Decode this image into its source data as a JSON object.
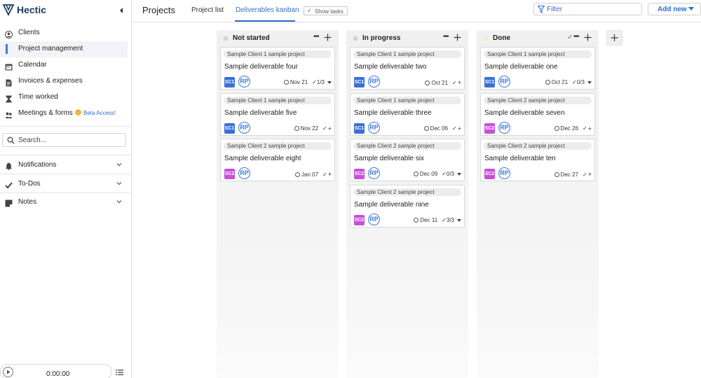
{
  "app": {
    "name": "Hectic"
  },
  "nav": {
    "items": [
      {
        "label": "Clients",
        "icon": "person-circle-icon"
      },
      {
        "label": "Project management",
        "icon": "kanban-icon",
        "active": true
      },
      {
        "label": "Calendar",
        "icon": "calendar-icon"
      },
      {
        "label": "Invoices & expenses",
        "icon": "document-icon"
      },
      {
        "label": "Time worked",
        "icon": "hourglass-icon"
      },
      {
        "label": "Meetings & forms",
        "icon": "people-icon"
      }
    ],
    "beta_label": "Beta Access!"
  },
  "search": {
    "placeholder": "Search..."
  },
  "sections": [
    {
      "label": "Notifications",
      "icon": "bell-icon"
    },
    {
      "label": "To-Dos",
      "icon": "check-icon"
    },
    {
      "label": "Notes",
      "icon": "notes-icon"
    }
  ],
  "timer": {
    "value": "0:00:00"
  },
  "header": {
    "title": "Projects",
    "tabs": [
      "Project list",
      "Deliverables kanban"
    ],
    "active_tab": 1,
    "show_tasks": "Show tasks",
    "filter_placeholder": "Filter",
    "add_new": "Add new"
  },
  "colors": {
    "accent": "#2f6ec9",
    "badge_sc1": "#3b6fd8",
    "badge_sc2": "#c94fd8",
    "status_not_started": "#cfd6de",
    "status_in_progress": "#b9d8f2",
    "status_done": "#f1ecc4"
  },
  "columns": [
    {
      "title": "Not started",
      "dot_color": "#cfd6de",
      "show_check": false,
      "cards": [
        {
          "project": "Sample Client 1 sample project",
          "title": "Sample deliverable four",
          "client": "SC1",
          "avatar": "RP",
          "date": "Nov 21",
          "tasks": "1/3",
          "tasks_mode": "caret"
        },
        {
          "project": "Sample Client 1 sample project",
          "title": "Sample deliverable five",
          "client": "SC1",
          "avatar": "RP",
          "date": "Nov 22",
          "tasks": "",
          "tasks_mode": "plus"
        },
        {
          "project": "Sample Client 2 sample project",
          "title": "Sample deliverable eight",
          "client": "SC2",
          "avatar": "RP",
          "date": "Jan 07",
          "tasks": "",
          "tasks_mode": "plus"
        }
      ]
    },
    {
      "title": "In progress",
      "dot_color": "#b9d8f2",
      "show_check": false,
      "cards": [
        {
          "project": "Sample Client 1 sample project",
          "title": "Sample deliverable two",
          "client": "SC1",
          "avatar": "RP",
          "date": "Oct 21",
          "tasks": "",
          "tasks_mode": "plus"
        },
        {
          "project": "Sample Client 1 sample project",
          "title": "Sample deliverable three",
          "client": "SC1",
          "avatar": "RP",
          "date": "Dec 06",
          "tasks": "",
          "tasks_mode": "plus"
        },
        {
          "project": "Sample Client 2 sample project",
          "title": "Sample deliverable six",
          "client": "SC2",
          "avatar": "RP",
          "date": "Dec 09",
          "tasks": "0/3",
          "tasks_mode": "caret"
        },
        {
          "project": "Sample Client 2 sample project",
          "title": "Sample deliverable nine",
          "client": "SC2",
          "avatar": "RP",
          "date": "Dec 11",
          "tasks": "3/3",
          "tasks_mode": "caret"
        }
      ]
    },
    {
      "title": "Done",
      "dot_color": "#f1ecc4",
      "show_check": true,
      "cards": [
        {
          "project": "Sample Client 1 sample project",
          "title": "Sample deliverable one",
          "client": "SC1",
          "avatar": "RP",
          "date": "Oct 21",
          "tasks": "0/3",
          "tasks_mode": "caret"
        },
        {
          "project": "Sample Client 2 sample project",
          "title": "Sample deliverable seven",
          "client": "SC2",
          "avatar": "RP",
          "date": "Dec 26",
          "tasks": "",
          "tasks_mode": "plus"
        },
        {
          "project": "Sample Client 2 sample project",
          "title": "Sample deliverable ten",
          "client": "SC2",
          "avatar": "RP",
          "date": "Dec 27",
          "tasks": "",
          "tasks_mode": "plus"
        }
      ]
    }
  ]
}
